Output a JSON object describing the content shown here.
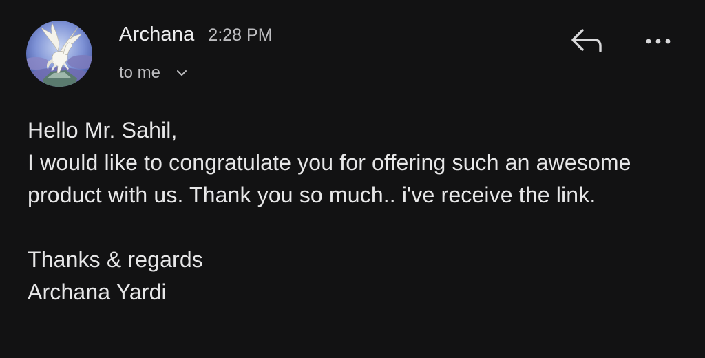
{
  "header": {
    "sender_name": "Archana",
    "time": "2:28 PM",
    "recipient": "to me",
    "icons": {
      "avatar": "pegasus-avatar",
      "recipient_expand": "chevron-down-icon",
      "reply": "reply-arrow-icon",
      "more": "more-horizontal-icon"
    }
  },
  "message": {
    "greeting": "Hello Mr. Sahil,",
    "paragraph": "I would like to congratulate you for offering such an awesome product with us. Thank you so much.. i've receive the link.",
    "closing": "Thanks & regards",
    "signature": "Archana Yardi"
  },
  "colors": {
    "background": "#121213",
    "text_primary": "#e9e9ea",
    "text_secondary": "#bdbdc0"
  }
}
